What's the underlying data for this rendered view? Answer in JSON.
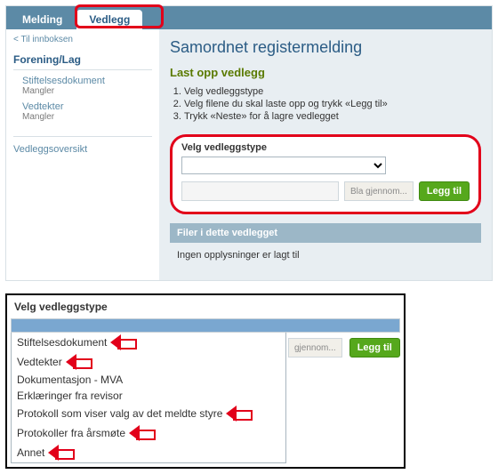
{
  "tabs": {
    "melding": "Melding",
    "vedlegg": "Vedlegg"
  },
  "back": "< Til innboksen",
  "sidebar": {
    "heading": "Forening/Lag",
    "items": [
      {
        "label": "Stiftelsesdokument",
        "status": "Mangler"
      },
      {
        "label": "Vedtekter",
        "status": "Mangler"
      }
    ],
    "link": "Vedleggsoversikt"
  },
  "main": {
    "title": "Samordnet registermelding",
    "subtitle": "Last opp vedlegg",
    "steps": [
      "Velg vedleggstype",
      "Velg filene du skal laste opp og trykk «Legg til»",
      "Trykk «Neste» for å lagre vedlegget"
    ],
    "form": {
      "label": "Velg vedleggstype",
      "browse": "Bla gjennom...",
      "add": "Legg til"
    },
    "files_bar": "Filer i dette vedlegget",
    "files_empty": "Ingen opplysninger er lagt til"
  },
  "dropdown": {
    "title": "Velg vedleggstype",
    "options": [
      "Stiftelsesdokument",
      "Vedtekter",
      "Dokumentasjon - MVA",
      "Erklæringer fra revisor",
      "Protokoll som viser valg av det meldte styre",
      "Protokoller fra årsmøte",
      "Annet"
    ],
    "browse": "gjennom...",
    "add": "Legg til"
  }
}
